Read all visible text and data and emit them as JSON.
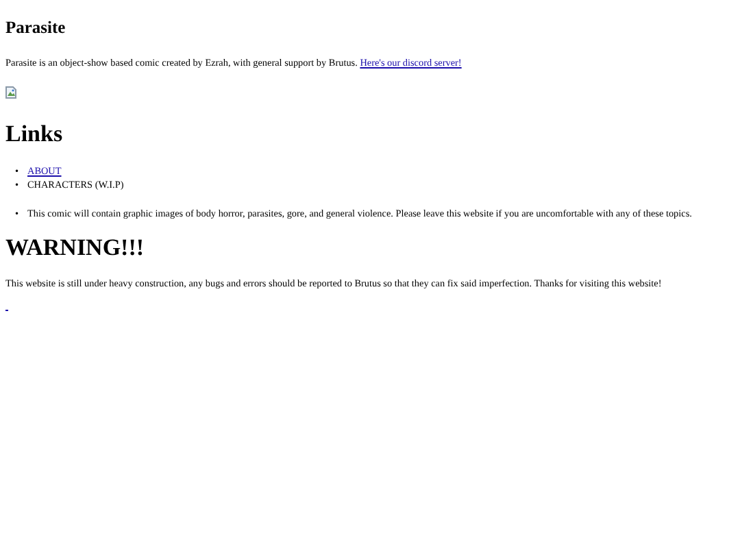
{
  "title": "Parasite",
  "intro": {
    "text": "Parasite is an object-show based comic created by Ezrah, with general support by Brutus.",
    "link": "Here's our discord server!"
  },
  "image": {
    "kind": "broken-image"
  },
  "links_heading": "Links",
  "links": [
    {
      "bullet": "•",
      "label": "ABOUT",
      "kind": "link"
    },
    {
      "bullet": "•",
      "label": "CHARACTERS (W.I.P)",
      "kind": "text"
    }
  ],
  "notices": [
    {
      "bullet": "•",
      "text": "This comic will contain graphic images of body horror, parasites, gore, and general violence. Please leave this website if you are uncomfortable with any of these topics."
    }
  ],
  "warning_heading": "WARNING!!!",
  "warning_text": "This website is still under heavy construction, any bugs and errors should be reported to Brutus so that they can fix said imperfection. Thanks for visiting this website!",
  "footer_link": {
    "kind": "tiny-link"
  }
}
